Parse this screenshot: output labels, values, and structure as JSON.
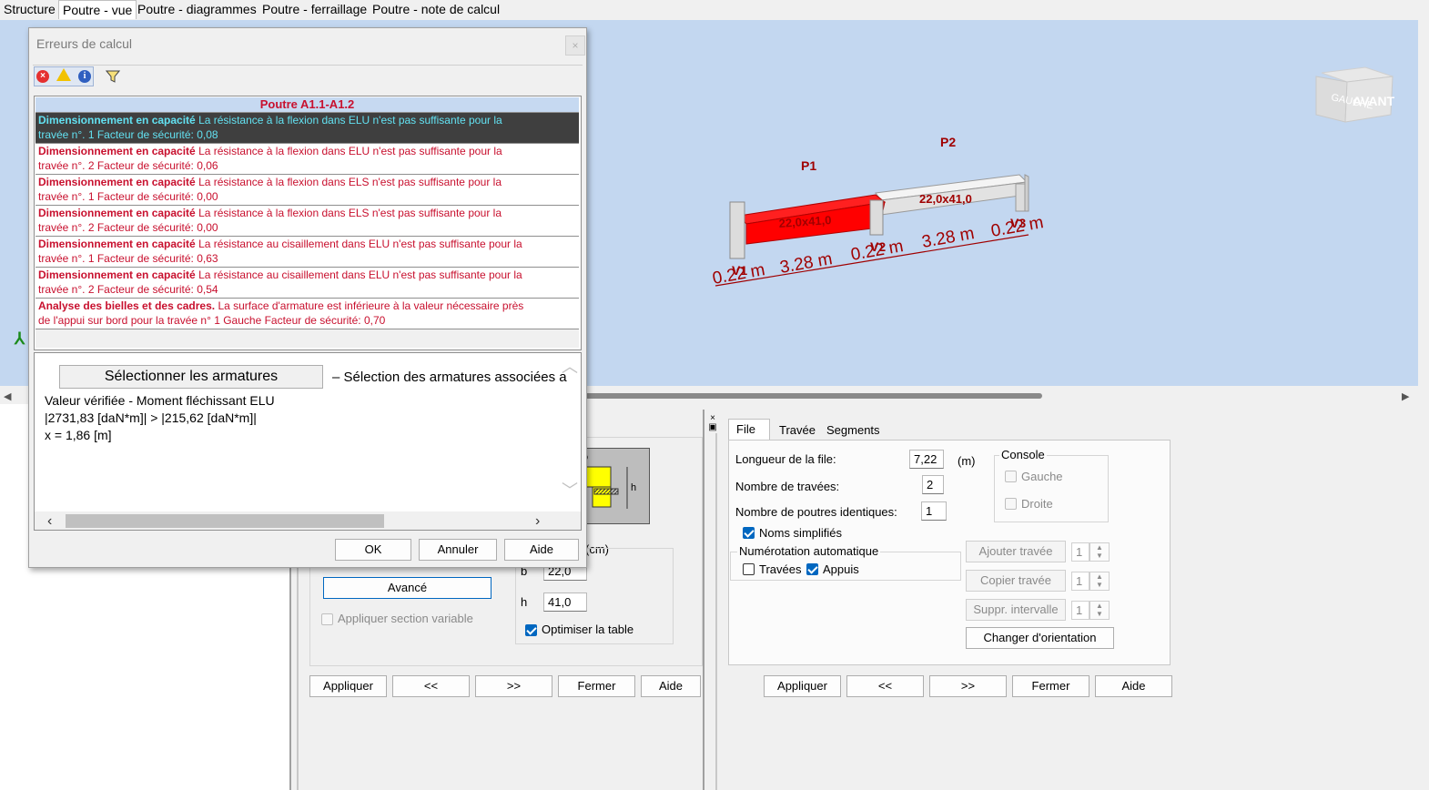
{
  "top_tabs": [
    "Structure",
    "Poutre - vue",
    "Poutre - diagrammes",
    "Poutre - ferraillage",
    "Poutre - note de calcul"
  ],
  "viewport": {
    "nav_cube": {
      "left": "GAUCHE",
      "front": "AVANT"
    },
    "span_labels": [
      "P1",
      "P2"
    ],
    "support_labels": [
      "V1",
      "V2",
      "V3"
    ],
    "section_labels": [
      "22,0x41,0",
      "22,0x41,0"
    ],
    "dimensions": [
      "0.22 m",
      "3.28 m",
      "0.22 m",
      "3.28 m",
      "0.22 m"
    ],
    "colors": {
      "background": "#c3d7f0",
      "error_span": "#ff0000",
      "beam": "#e6e6e6"
    }
  },
  "dialog": {
    "title": "Erreurs de calcul",
    "toolbar_icons": [
      "error-icon",
      "warning-icon",
      "info-icon",
      "filter-icon"
    ],
    "table_header": "Poutre A1.1-A1.2",
    "errors": [
      {
        "title": "Dimensionnement en capacité",
        "text": "La résistance à la flexion dans ELU n'est pas suffisante pour la",
        "text2": "travée n°. 1  Facteur de sécurité: 0,08"
      },
      {
        "title": "Dimensionnement en capacité",
        "text": "La résistance à la flexion dans ELU n'est pas suffisante pour la",
        "text2": "travée n°. 2  Facteur de sécurité: 0,06"
      },
      {
        "title": "Dimensionnement en capacité",
        "text": "La résistance à la flexion dans ELS n'est pas suffisante pour la",
        "text2": "travée n°. 1  Facteur de sécurité: 0,00"
      },
      {
        "title": "Dimensionnement en capacité",
        "text": "La résistance à la flexion dans ELS n'est pas suffisante pour la",
        "text2": "travée n°. 2  Facteur de sécurité: 0,00"
      },
      {
        "title": "Dimensionnement en capacité",
        "text": "La résistance au cisaillement dans ELU n'est pas suffisante pour la",
        "text2": "travée n°. 1  Facteur de sécurité: 0,63"
      },
      {
        "title": "Dimensionnement en capacité",
        "text": "La résistance au cisaillement dans ELU n'est pas suffisante pour la",
        "text2": "travée n°. 2  Facteur de sécurité: 0,54"
      },
      {
        "title": "Analyse des bielles et des cadres.",
        "text": "La surface d'armature est inférieure à la valeur nécessaire près",
        "text2": "de l'appui sur bord pour la travée n°  1  Gauche Facteur de sécurité: 0,70"
      }
    ],
    "detail": {
      "select_button": "Sélectionner les armatures",
      "select_hint": "– Sélection des armatures associées a",
      "lines": [
        "Valeur vérifiée - Moment fléchissant ELU",
        "|2731,83 [daN*m]| > |215,62 [daN*m]|",
        "x = 1,86 [m]"
      ]
    },
    "buttons": {
      "ok": "OK",
      "cancel": "Annuler",
      "help": "Aide"
    }
  },
  "left_panel": {
    "unit_label": "(cm)",
    "advanced_button": "Avancé",
    "variable_section_label": "Appliquer section variable",
    "b_label": "b",
    "b_value": "22,0",
    "h_label": "h",
    "h_value": "41,0",
    "optimize_label": "Optimiser la table",
    "diagram_labels": {
      "b": "b",
      "h": "h"
    },
    "buttons": [
      "Appliquer",
      "<<",
      ">>",
      "Fermer",
      "Aide"
    ]
  },
  "right_panel": {
    "tabs": [
      "File",
      "Travée",
      "Segments"
    ],
    "length_label": "Longueur de la file:",
    "length_value": "7,22",
    "length_unit": "(m)",
    "spans_label": "Nombre de travées:",
    "spans_value": "2",
    "identical_label": "Nombre de poutres identiques:",
    "identical_value": "1",
    "simplified_names_label": "Noms simplifiés",
    "auto_numbering_label": "Numérotation automatique",
    "travees_label": "Travées",
    "appuis_label": "Appuis",
    "console_label": "Console",
    "console_left": "Gauche",
    "console_right": "Droite",
    "add_span": "Ajouter travée",
    "add_span_value": "1",
    "copy_span": "Copier travée",
    "copy_span_value": "1",
    "delete_interval": "Suppr. intervalle",
    "delete_interval_value": "1",
    "change_orientation": "Changer d'orientation",
    "buttons": [
      "Appliquer",
      "<<",
      ">>",
      "Fermer",
      "Aide"
    ]
  }
}
